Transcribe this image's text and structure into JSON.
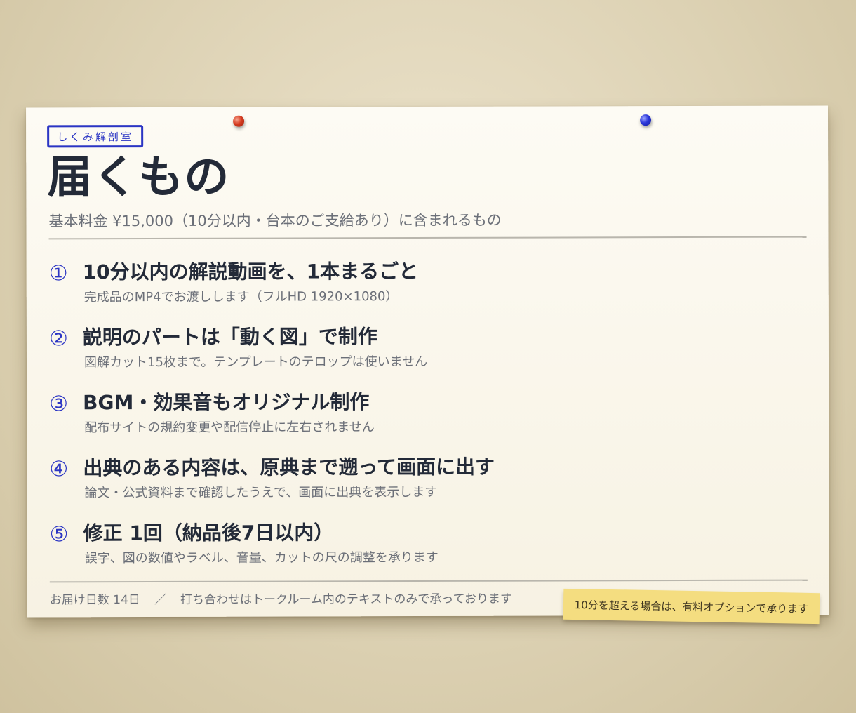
{
  "card": {
    "tag": "しくみ解剖室",
    "title": "届くもの",
    "subtitle": "基本料金 ¥15,000（10分以内・台本のご支給あり）に含まれるもの"
  },
  "items": [
    {
      "num": "①",
      "title": "10分以内の解説動画を、1本まるごと",
      "desc": "完成品のMP4でお渡しします（フルHD 1920×1080）"
    },
    {
      "num": "②",
      "title": "説明のパートは「動く図」で制作",
      "desc": "図解カット15枚まで。テンプレートのテロップは使いません"
    },
    {
      "num": "③",
      "title": "BGM・効果音もオリジナル制作",
      "desc": "配布サイトの規約変更や配信停止に左右されません"
    },
    {
      "num": "④",
      "title": "出典のある内容は、原典まで遡って画面に出す",
      "desc": "論文・公式資料まで確認したうえで、画面に出典を表示します"
    },
    {
      "num": "⑤",
      "title": "修正 1回（納品後7日以内）",
      "desc": "誤字、図の数値やラベル、音量、カットの尺の調整を承ります"
    }
  ],
  "footer": {
    "delivery": "お届け日数 14日",
    "separator": "／",
    "note": "打ち合わせはトークルーム内のテキストのみで承っております"
  },
  "sticky_note": "10分を超える場合は、有料オプションで承ります",
  "colors": {
    "accent": "#2b35c4",
    "pin_red": "#d63b20",
    "pin_blue": "#2a36d9",
    "sticky": "#f4dd80",
    "paper": "#fbf8ee"
  }
}
